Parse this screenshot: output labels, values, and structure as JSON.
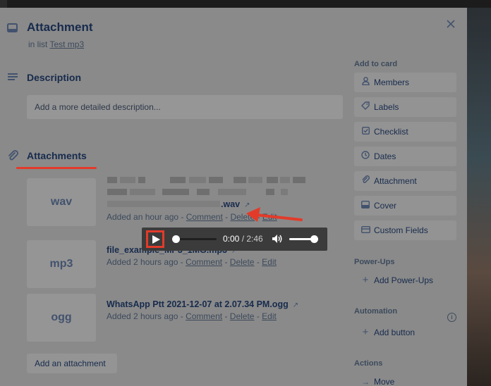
{
  "card": {
    "title": "Attachment",
    "list_prefix": "in list",
    "list_name": "Test mp3"
  },
  "description": {
    "heading": "Description",
    "placeholder": "Add a more detailed description..."
  },
  "attachments": {
    "heading": "Attachments",
    "items": [
      {
        "thumb": "wav",
        "name": ".wav",
        "meta_prefix": "Added an hour ago -",
        "comment": "Comment",
        "delete": "Delete",
        "edit": "Edit",
        "sep": "-"
      },
      {
        "thumb": "mp3",
        "name": "file_example_MP3_1MG.mp3",
        "meta_prefix": "Added 2 hours ago -",
        "comment": "Comment",
        "delete": "Delete",
        "edit": "Edit",
        "sep": "-"
      },
      {
        "thumb": "ogg",
        "name": "WhatsApp Ptt 2021-12-07 at 2.07.34 PM.ogg",
        "meta_prefix": "Added 2 hours ago -",
        "comment": "Comment",
        "delete": "Delete",
        "edit": "Edit",
        "sep": "-"
      }
    ],
    "add_button": "Add an attachment"
  },
  "player": {
    "current_time": "0:00",
    "separator": " / ",
    "duration": "2:46",
    "progress_fraction": 0.0,
    "volume_fraction": 1.0
  },
  "sidebar": {
    "add_to_card": {
      "heading": "Add to card",
      "items": [
        {
          "label": "Members",
          "icon": "person-icon"
        },
        {
          "label": "Labels",
          "icon": "tag-icon"
        },
        {
          "label": "Checklist",
          "icon": "checkbox-icon"
        },
        {
          "label": "Dates",
          "icon": "clock-icon"
        },
        {
          "label": "Attachment",
          "icon": "paperclip-icon"
        },
        {
          "label": "Cover",
          "icon": "cover-icon"
        },
        {
          "label": "Custom Fields",
          "icon": "custom-fields-icon"
        }
      ]
    },
    "power_ups": {
      "heading": "Power-Ups",
      "add_label": "Add Power-Ups"
    },
    "automation": {
      "heading": "Automation",
      "add_label": "Add button"
    },
    "actions": {
      "heading": "Actions",
      "move_label": "Move"
    }
  },
  "colors": {
    "highlight_red": "#e23b2a",
    "modal_bg": "#8a8a8a",
    "player_bg": "#3b3b3b"
  }
}
